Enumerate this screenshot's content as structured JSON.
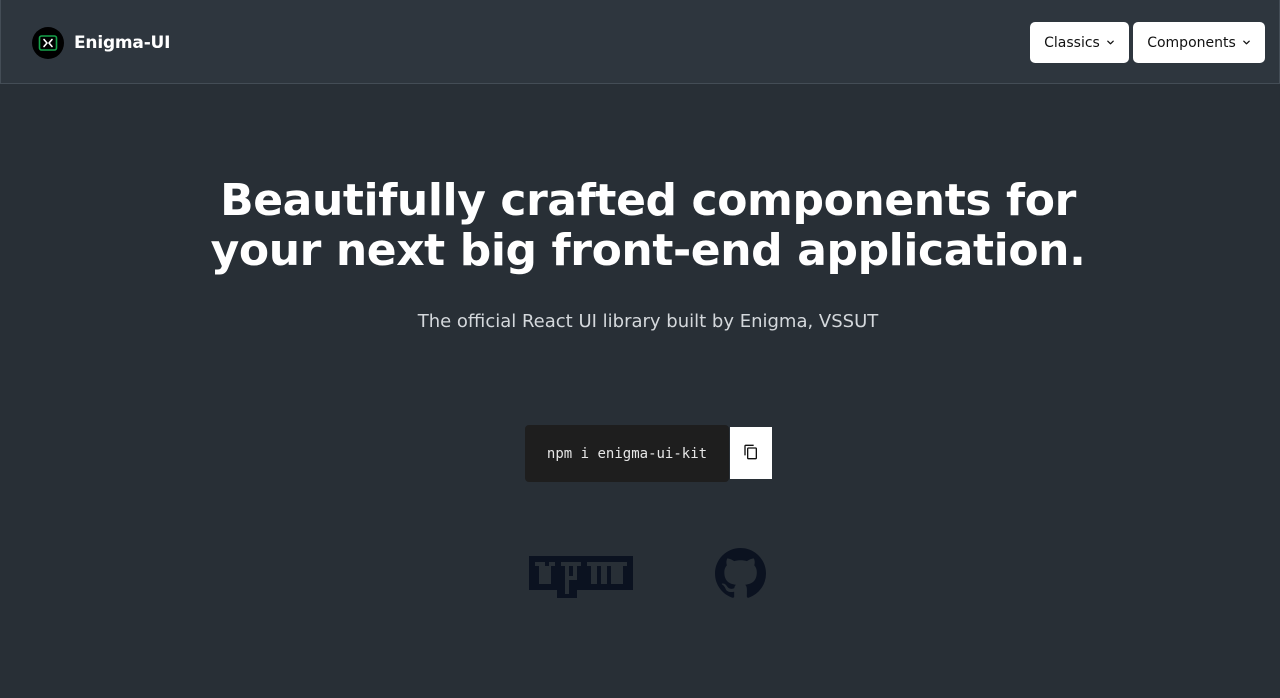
{
  "header": {
    "brand_name": "Enigma-UI",
    "logo_icon": "enigma-logo-icon",
    "menus": [
      {
        "label": "Classics",
        "icon": "chevron-down-icon"
      },
      {
        "label": "Components",
        "icon": "chevron-down-icon"
      }
    ]
  },
  "hero": {
    "title_line1": "Beautifully crafted components for",
    "title_line2": "your next big front-end application.",
    "subtitle": "The official React UI library built by Enigma, VSSUT"
  },
  "install": {
    "command": "npm i enigma-ui-kit",
    "copy_icon": "copy-icon"
  },
  "links": {
    "npm_icon": "npm-logo-icon",
    "github_icon": "github-icon"
  },
  "colors": {
    "background": "#282f36",
    "navbar": "#2e363e",
    "button_bg": "#ffffff",
    "code_bg": "#1e1e1e",
    "logo_accent": "#16a34a",
    "social_icon": "#0b1220"
  }
}
